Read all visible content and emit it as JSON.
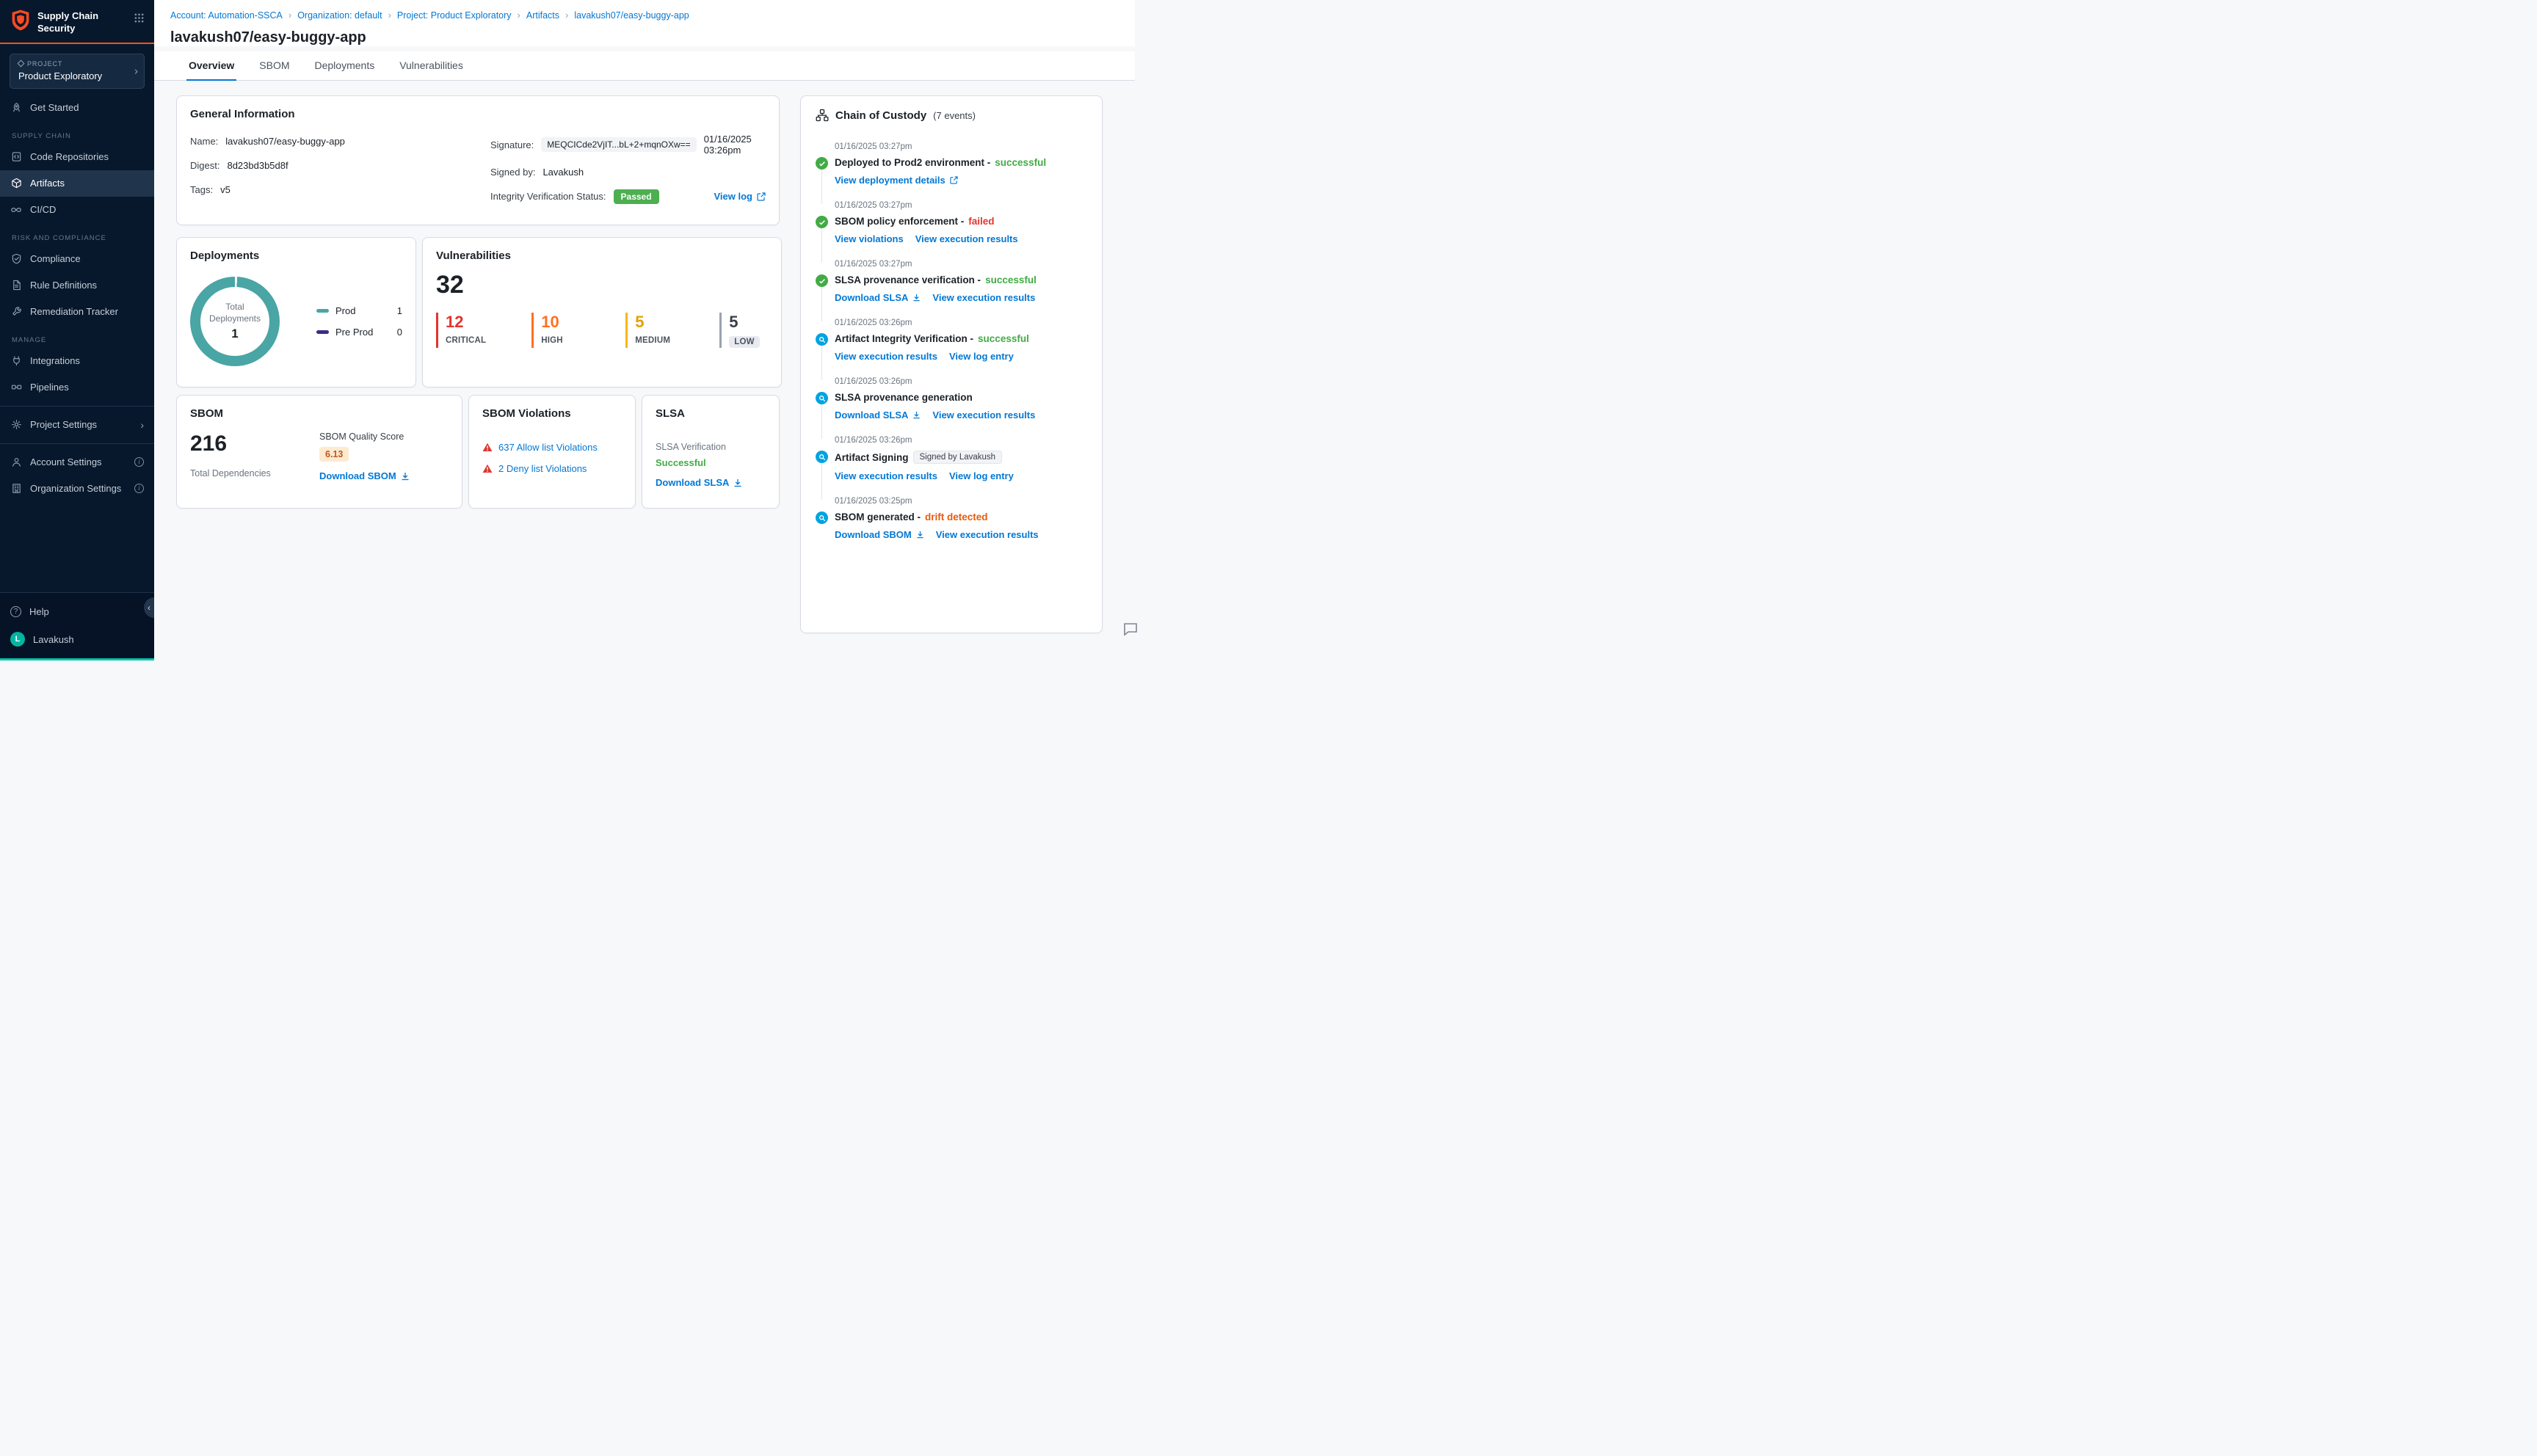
{
  "colors": {
    "link_blue": "#0278d5",
    "success_green": "#42ab45",
    "badge_green": "#4caf50",
    "critical_red": "#e3342f",
    "high_orange": "#ff7020",
    "medium_amber": "#e5a000",
    "teal": "#4aa5a5",
    "pre_prod_purple": "#392e87",
    "drift_orange": "#e8590c",
    "event_blue": "#00a3e0",
    "sidebar_bg": "#07182c",
    "brand_orange": "#ff5310"
  },
  "icons": {
    "chevron_right": "›",
    "chevron_left": "‹",
    "breadcrumb_separator": "›",
    "info": "i",
    "question": "?"
  },
  "sidebar": {
    "app_title": "Supply Chain Security",
    "project_label": "PROJECT",
    "project_name": "Product Exploratory",
    "nav": [
      "Get Started",
      "SUPPLY CHAIN",
      "Code Repositories",
      "Artifacts",
      "CI/CD",
      "RISK AND COMPLIANCE",
      "Compliance",
      "Rule Definitions",
      "Remediation Tracker",
      "MANAGE",
      "Integrations",
      "Pipelines",
      "Project Settings",
      "Account Settings",
      "Organization Settings"
    ],
    "help": "Help",
    "user_initial": "L",
    "user_name": "Lavakush"
  },
  "breadcrumbs": [
    "Account: Automation-SSCA",
    "Organization: default",
    "Project: Product Exploratory",
    "Artifacts",
    "lavakush07/easy-buggy-app"
  ],
  "page_title": "lavakush07/easy-buggy-app",
  "tabs": [
    "Overview",
    "SBOM",
    "Deployments",
    "Vulnerabilities"
  ],
  "general_info": {
    "title": "General Information",
    "name_label": "Name:",
    "name_value": "lavakush07/easy-buggy-app",
    "digest_label": "Digest:",
    "digest_value": "8d23bd3b5d8f",
    "tags_label": "Tags:",
    "tags_value": "v5",
    "signature_label": "Signature:",
    "signature_value": "MEQCICde2VjIT...bL+2+mqnOXw==",
    "signature_date": "01/16/2025 03:26pm",
    "signed_by_label": "Signed by:",
    "signed_by_value": "Lavakush",
    "integrity_label": "Integrity Verification Status:",
    "integrity_badge": "Passed",
    "view_log": "View log"
  },
  "deployments": {
    "title": "Deployments",
    "center_label_line1": "Total",
    "center_label_line2": "Deployments",
    "total": "1",
    "legend": [
      {
        "label": "Prod",
        "value": "1"
      },
      {
        "label": "Pre Prod",
        "value": "0"
      }
    ]
  },
  "vulnerabilities": {
    "title": "Vulnerabilities",
    "total": "32",
    "severities": [
      {
        "label": "CRITICAL",
        "value": "12"
      },
      {
        "label": "HIGH",
        "value": "10"
      },
      {
        "label": "MEDIUM",
        "value": "5"
      },
      {
        "label": "LOW",
        "value": "5"
      }
    ]
  },
  "sbom": {
    "title": "SBOM",
    "total": "216",
    "total_label": "Total Dependencies",
    "quality_label": "SBOM Quality Score",
    "quality_score": "6.13",
    "download": "Download SBOM"
  },
  "sbom_violations": {
    "title": "SBOM Violations",
    "allow": "637 Allow list Violations",
    "deny": "2 Deny list Violations"
  },
  "slsa": {
    "title": "SLSA",
    "verification_label": "SLSA Verification",
    "status": "Successful",
    "download": "Download SLSA"
  },
  "chain_of_custody": {
    "title": "Chain of Custody",
    "count": "(7 events)",
    "events": [
      {
        "time": "01/16/2025 03:27pm",
        "title": "Deployed to Prod2 environment -",
        "status": "successful",
        "link1": "View deployment details"
      },
      {
        "time": "01/16/2025 03:27pm",
        "title": "SBOM policy enforcement -",
        "status": "failed",
        "link1": "View violations",
        "link2": "View execution results"
      },
      {
        "time": "01/16/2025 03:27pm",
        "title": "SLSA provenance verification -",
        "status": "successful",
        "link1": "Download SLSA",
        "link2": "View execution results"
      },
      {
        "time": "01/16/2025 03:26pm",
        "title": "Artifact Integrity Verification -",
        "status": "successful",
        "link1": "View execution results",
        "link2": "View log entry"
      },
      {
        "time": "01/16/2025 03:26pm",
        "title": "SLSA provenance generation",
        "link1": "Download SLSA",
        "link2": "View execution results"
      },
      {
        "time": "01/16/2025 03:26pm",
        "title": "Artifact Signing",
        "chip": "Signed by Lavakush",
        "link1": "View execution results",
        "link2": "View log entry"
      },
      {
        "time": "01/16/2025 03:25pm",
        "title": "SBOM generated -",
        "status": "drift detected",
        "link1": "Download SBOM",
        "link2": "View execution results"
      }
    ]
  }
}
